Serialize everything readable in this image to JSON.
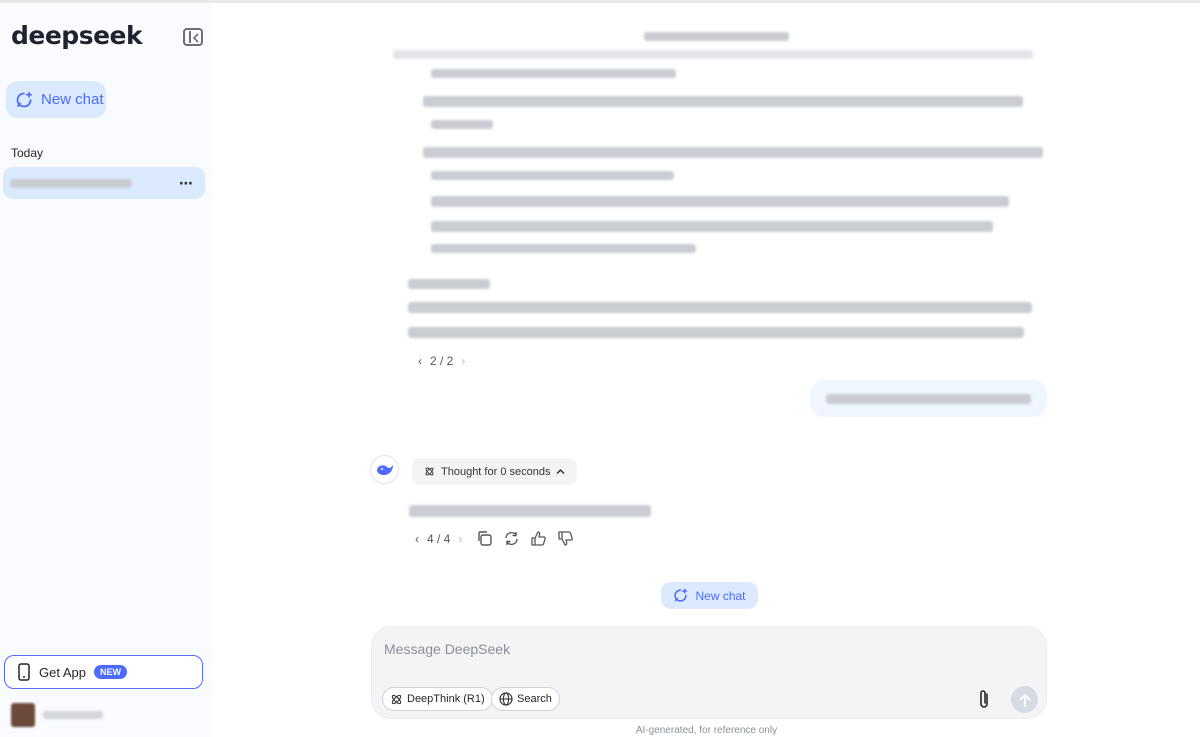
{
  "app": {
    "logo_text": "deepseek",
    "accent_color": "#4d6bfe"
  },
  "sidebar": {
    "new_chat_label": "New chat",
    "section_today": "Today",
    "history_menu": "⋯",
    "get_app_label": "Get App",
    "get_app_badge": "NEW"
  },
  "conversation": {
    "pager_1": "2 / 2",
    "thought_label": "Thought for 0 seconds",
    "pager_2": "4 / 4",
    "new_chat_label": "New chat"
  },
  "composer": {
    "placeholder": "Message DeepSeek",
    "deepthink_label": "DeepThink (R1)",
    "search_label": "Search"
  },
  "footer": {
    "note": "AI-generated, for reference only"
  }
}
